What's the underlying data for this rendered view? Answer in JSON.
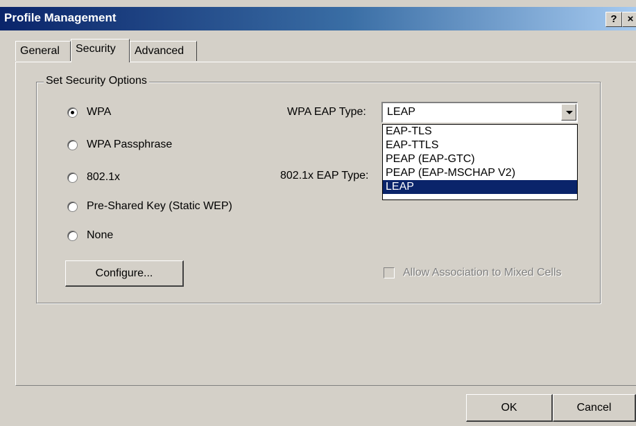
{
  "window": {
    "title": "Profile Management",
    "help_button": "?",
    "close_button": "×"
  },
  "tabs": [
    {
      "label": "General",
      "active": false
    },
    {
      "label": "Security",
      "active": true
    },
    {
      "label": "Advanced",
      "active": false
    }
  ],
  "security": {
    "group_label": "Set Security Options",
    "options": [
      {
        "label": "WPA",
        "checked": true
      },
      {
        "label": "WPA Passphrase",
        "checked": false
      },
      {
        "label": "802.1x",
        "checked": false
      },
      {
        "label": "Pre-Shared Key (Static WEP)",
        "checked": false
      },
      {
        "label": "None",
        "checked": false
      }
    ],
    "wpa_eap_label": "WPA EAP Type:",
    "wpa_eap_value": "LEAP",
    "dot1x_eap_label": "802.1x EAP Type:",
    "dropdown_options": [
      {
        "label": "EAP-TLS",
        "selected": false
      },
      {
        "label": "EAP-TTLS",
        "selected": false
      },
      {
        "label": "PEAP (EAP-GTC)",
        "selected": false
      },
      {
        "label": "PEAP (EAP-MSCHAP V2)",
        "selected": false
      },
      {
        "label": "LEAP",
        "selected": true
      }
    ],
    "configure_label": "Configure...",
    "mixed_cells_label": "Allow Association to Mixed Cells",
    "mixed_cells_checked": false
  },
  "footer": {
    "ok_label": "OK",
    "cancel_label": "Cancel"
  }
}
